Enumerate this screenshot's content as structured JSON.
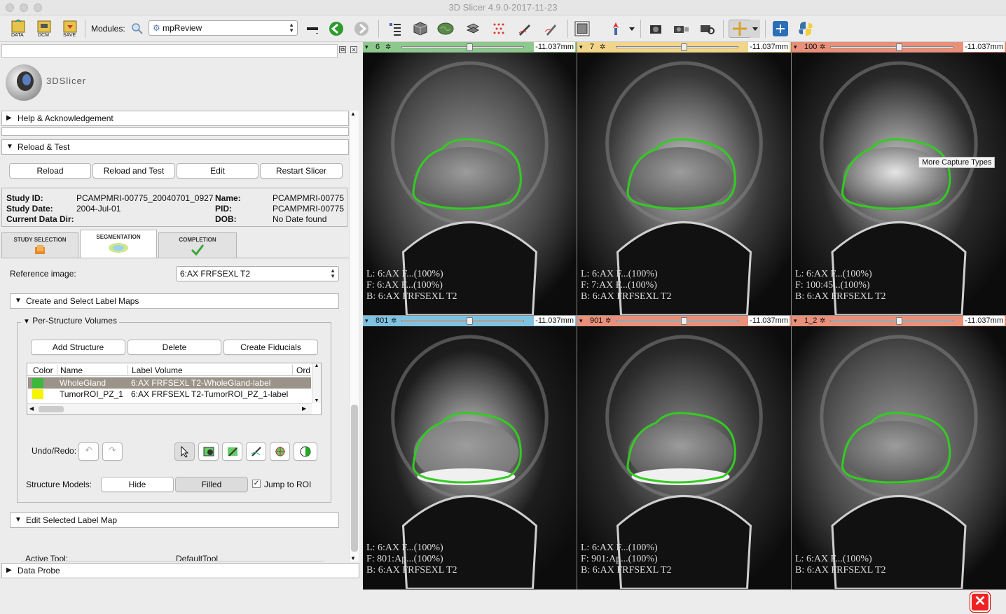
{
  "window": {
    "title": "3D Slicer 4.9.0-2017-11-23"
  },
  "toolbar": {
    "data_label": "DATA",
    "dcm_label": "DCM",
    "save_label": "SAVE",
    "modules_label": "Modules:",
    "module_value": "mpReview"
  },
  "logo": {
    "text": "3DSlicer"
  },
  "sections": {
    "help": "Help & Acknowledgement",
    "reload_test": "Reload & Test",
    "create_select": "Create and Select Label Maps",
    "per_structure": "Per-Structure Volumes",
    "edit_selected": "Edit Selected Label Map",
    "data_probe": "Data Probe"
  },
  "reload_buttons": [
    "Reload",
    "Reload and Test",
    "Edit",
    "Restart Slicer"
  ],
  "study": {
    "study_id_label": "Study ID:",
    "study_id": "PCAMPMRI-00775_20040701_0927",
    "study_date_label": "Study Date:",
    "study_date": "2004-Jul-01",
    "data_dir_label": "Current Data Dir:",
    "data_dir": "",
    "name_label": "Name:",
    "name": "PCAMPMRI-00775",
    "pid_label": "PID:",
    "pid": "PCAMPMRI-00775",
    "dob_label": "DOB:",
    "dob": "No Date found"
  },
  "tabs": [
    "STUDY SELECTION",
    "SEGMENTATION",
    "COMPLETION"
  ],
  "reference": {
    "label": "Reference image:",
    "value": "6:AX FRFSEXL T2"
  },
  "structure_buttons": [
    "Add Structure",
    "Delete",
    "Create Fiducials"
  ],
  "table": {
    "headers": [
      "Color",
      "Name",
      "Label Volume",
      "Ord"
    ],
    "rows": [
      {
        "color": "#3cb83c",
        "name": "WholeGland",
        "volume": "6:AX FRFSEXL T2-WholeGland-label"
      },
      {
        "color": "#f5f500",
        "name": "TumorROI_PZ_1",
        "volume": "6:AX FRFSEXL T2-TumorROI_PZ_1-label"
      }
    ]
  },
  "undo_redo_label": "Undo/Redo:",
  "structure_models": {
    "label": "Structure Models:",
    "hide": "Hide",
    "filled": "Filled",
    "jump": "Jump to ROI",
    "jump_checked": true
  },
  "active_tool": {
    "label": "Active Tool:",
    "value": "DefaultTool"
  },
  "tooltip": "More Capture Types",
  "views": [
    {
      "num": "6",
      "mm": "-11.037mm",
      "color": "#8dc88d",
      "slider": 0.55,
      "l": "L: 6:AX F...(100%)",
      "f": "F: 6:AX F...(100%)",
      "b": "B: 6:AX FRFSEXL T2"
    },
    {
      "num": "7",
      "mm": "-11.037mm",
      "color": "#f0d58a",
      "slider": 0.55,
      "l": "L: 6:AX F...(100%)",
      "f": "F: 7:AX F...(100%)",
      "b": "B: 6:AX FRFSEXL T2"
    },
    {
      "num": "100",
      "mm": "-11.037mm",
      "color": "#e8907a",
      "slider": 0.55,
      "l": "L: 6:AX F...(100%)",
      "f": "F: 100:45...(100%)",
      "b": "B: 6:AX FRFSEXL T2"
    },
    {
      "num": "801",
      "mm": "-11.037mm",
      "color": "#7fc2e0",
      "slider": 0.55,
      "l": "L: 6:AX F...(100%)",
      "f": "F: 801:Ap...(100%)",
      "b": "B: 6:AX FRFSEXL T2"
    },
    {
      "num": "901",
      "mm": "-11.037mm",
      "color": "#e8907a",
      "slider": 0.55,
      "l": "L: 6:AX F...(100%)",
      "f": "F: 901:Ap...(100%)",
      "b": "B: 6:AX FRFSEXL T2"
    },
    {
      "num": "1_2",
      "mm": "-11.037mm",
      "color": "#e8907a",
      "slider": 0.55,
      "l": "L: 6:AX F...(100%)",
      "f": "",
      "b": "B: 6:AX FRFSEXL T2"
    }
  ]
}
